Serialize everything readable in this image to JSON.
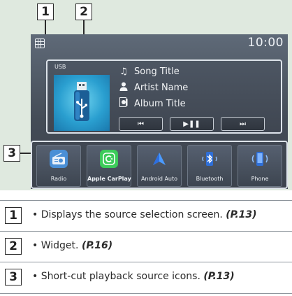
{
  "callouts": [
    "1",
    "2",
    "3"
  ],
  "screen": {
    "clock": "10:00",
    "widget": {
      "source_tag": "USB",
      "song_title": "Song Title",
      "artist_name": "Artist Name",
      "album_title": "Album Title",
      "controls": {
        "prev_icon": "skip-previous-icon",
        "play_pause_icon": "play-pause-icon",
        "next_icon": "skip-next-icon"
      }
    },
    "shortcuts": [
      {
        "label": "Radio",
        "icon": "radio-icon",
        "color": "#4a8fd6"
      },
      {
        "label": "Apple CarPlay",
        "icon": "carplay-icon",
        "color": "#3ccb5a"
      },
      {
        "label": "Android Auto",
        "icon": "android-auto-icon",
        "color": "#3b82f0"
      },
      {
        "label": "Bluetooth",
        "icon": "bluetooth-icon",
        "color": "#2f6fd8"
      },
      {
        "label": "Phone",
        "icon": "phone-icon",
        "color": "#2f6fd8"
      }
    ]
  },
  "legend": [
    {
      "num": "1",
      "text": "Displays the source selection screen.",
      "ref": "(P.13)"
    },
    {
      "num": "2",
      "text": "Widget.",
      "ref": "(P.16)"
    },
    {
      "num": "3",
      "text": "Short-cut playback source icons.",
      "ref": "(P.13)"
    }
  ]
}
